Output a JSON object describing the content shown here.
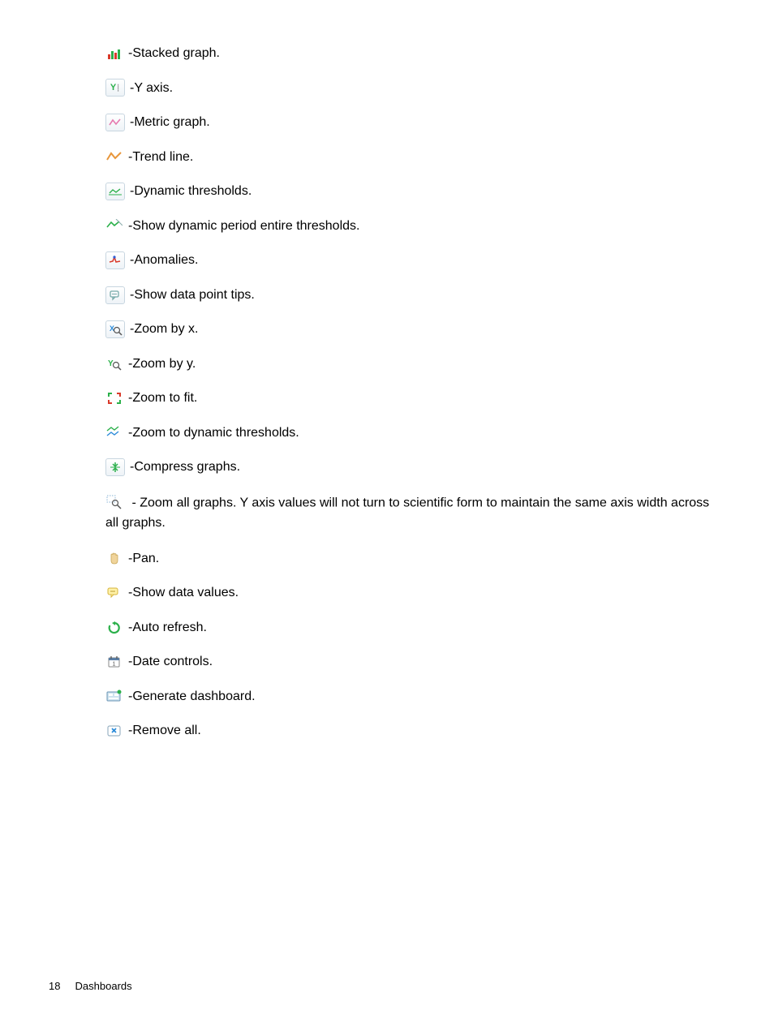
{
  "items": [
    {
      "label": "Stacked graph."
    },
    {
      "label": "Y axis."
    },
    {
      "label": "Metric graph."
    },
    {
      "label": "Trend line."
    },
    {
      "label": "Dynamic thresholds."
    },
    {
      "label": "Show dynamic period entire thresholds."
    },
    {
      "label": "Anomalies."
    },
    {
      "label": "Show data point tips."
    },
    {
      "label": "Zoom by x."
    },
    {
      "label": "Zoom by y."
    },
    {
      "label": "Zoom to fit."
    },
    {
      "label": "Zoom to dynamic thresholds."
    },
    {
      "label": "Compress graphs."
    },
    {
      "label": "Zoom all graphs. Y axis values will not turn to scientific form to maintain the same axis width across all graphs."
    },
    {
      "label": "Pan."
    },
    {
      "label": "Show data values."
    },
    {
      "label": "Auto refresh."
    },
    {
      "label": "Date controls."
    },
    {
      "label": "Generate dashboard."
    },
    {
      "label": "Remove all."
    }
  ],
  "footer": {
    "page_number": "18",
    "section": "Dashboards"
  },
  "separator": " - "
}
